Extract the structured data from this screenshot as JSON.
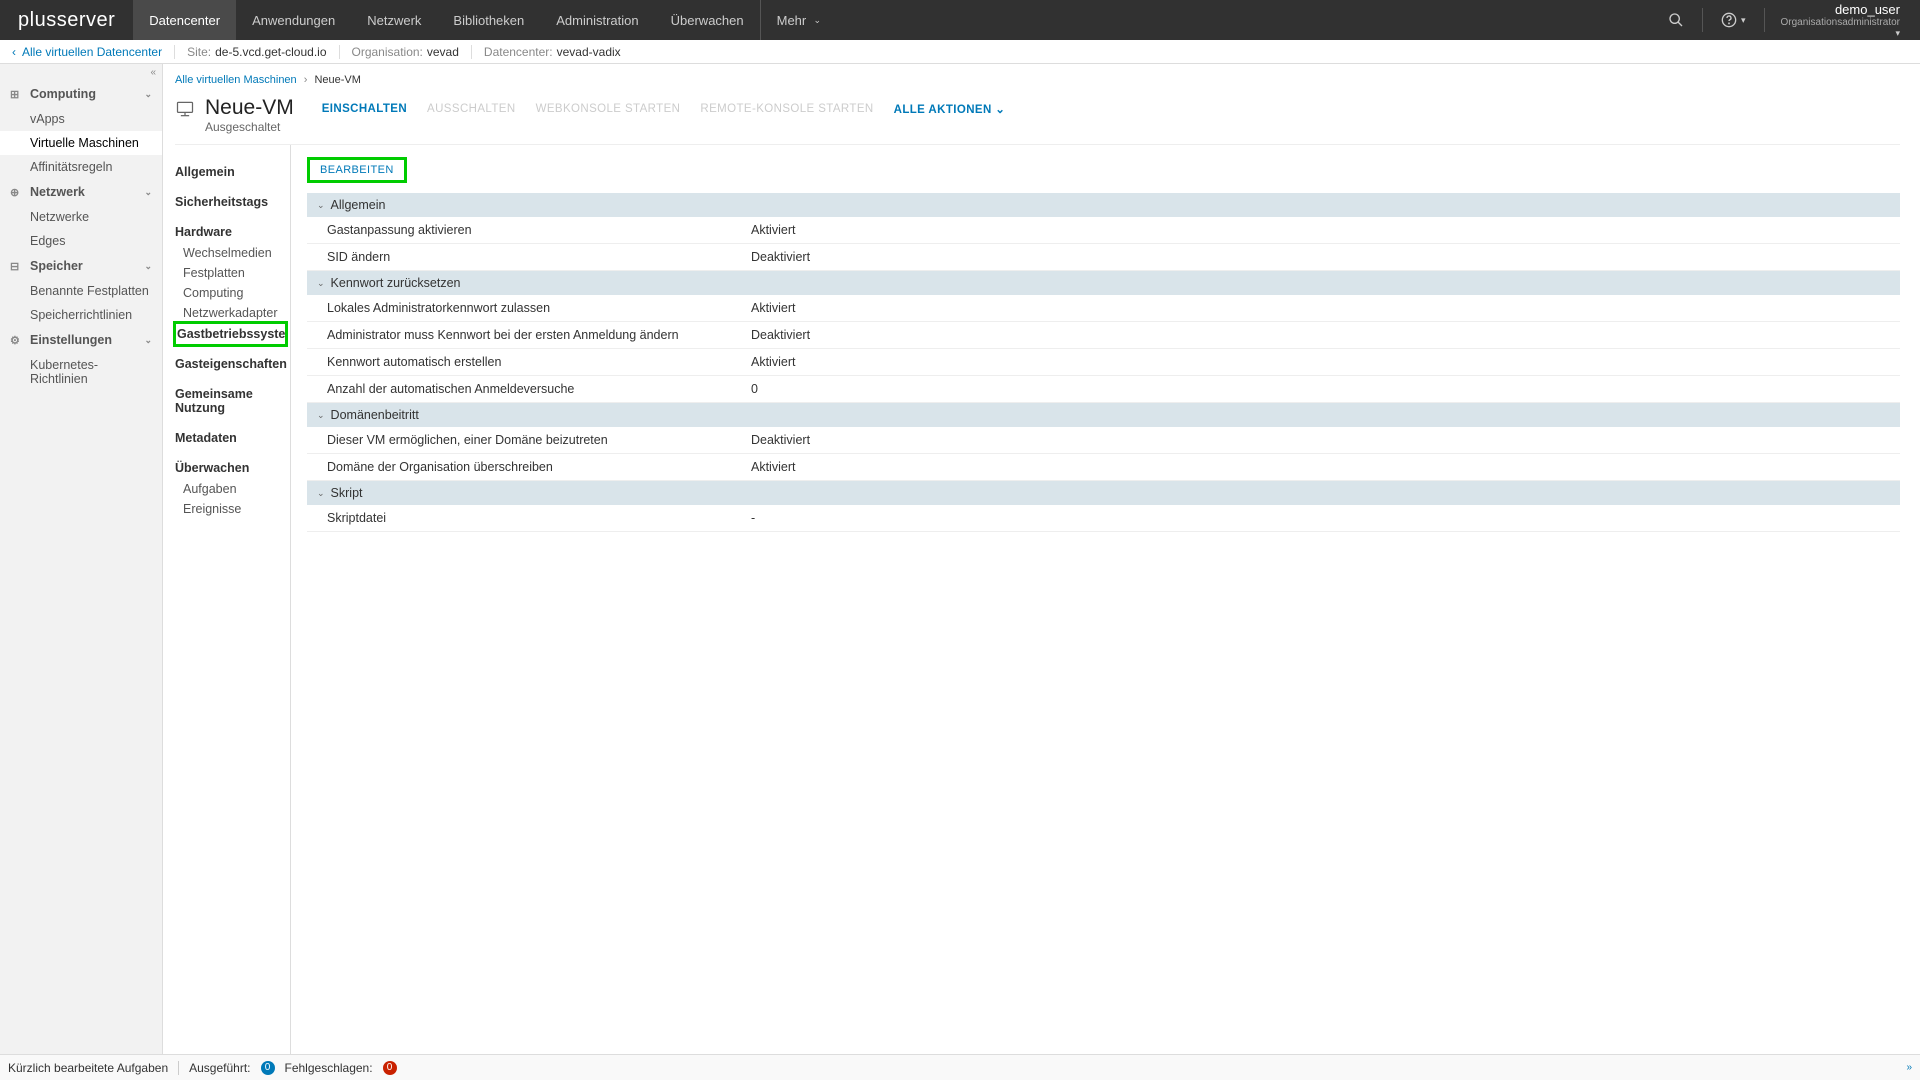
{
  "brand": "plusserver",
  "topnav": {
    "tabs": [
      "Datencenter",
      "Anwendungen",
      "Netzwerk",
      "Bibliotheken",
      "Administration",
      "Überwachen",
      "Mehr"
    ],
    "active": 0
  },
  "user": {
    "name": "demo_user",
    "role": "Organisationsadministrator"
  },
  "subheader": {
    "back": "Alle virtuellen Datencenter",
    "site_lab": "Site:",
    "site_val": "de-5.vcd.get-cloud.io",
    "org_lab": "Organisation:",
    "org_val": "vevad",
    "dc_lab": "Datencenter:",
    "dc_val": "vevad-vadix"
  },
  "sidebar": {
    "groups": [
      {
        "label": "Computing",
        "icon": "⊞",
        "items": [
          "vApps",
          "Virtuelle Maschinen",
          "Affinitätsregeln"
        ],
        "activeIndex": 1
      },
      {
        "label": "Netzwerk",
        "icon": "⊕",
        "items": [
          "Netzwerke",
          "Edges"
        ]
      },
      {
        "label": "Speicher",
        "icon": "⊟",
        "items": [
          "Benannte Festplatten",
          "Speicherrichtlinien"
        ]
      },
      {
        "label": "Einstellungen",
        "icon": "⚙",
        "items": [
          "Kubernetes-Richtlinien"
        ]
      }
    ]
  },
  "breadcrumb": {
    "root": "Alle virtuellen Maschinen",
    "current": "Neue-VM"
  },
  "vm": {
    "name": "Neue-VM",
    "status": "Ausgeschaltet"
  },
  "actions": {
    "einschalten": "EINSCHALTEN",
    "ausschalten": "AUSSCHALTEN",
    "web": "WEBKONSOLE STARTEN",
    "remote": "REMOTE-KONSOLE STARTEN",
    "all": "ALLE AKTIONEN ⌄"
  },
  "detailnav": {
    "items": [
      {
        "label": "Allgemein",
        "type": "main"
      },
      {
        "label": "Sicherheitstags",
        "type": "main"
      },
      {
        "label": "Hardware",
        "type": "main"
      },
      {
        "label": "Wechselmedien",
        "type": "sub"
      },
      {
        "label": "Festplatten",
        "type": "sub"
      },
      {
        "label": "Computing",
        "type": "sub"
      },
      {
        "label": "Netzwerkadapter",
        "type": "sub"
      },
      {
        "label": "Gastbetriebssystemanpassung",
        "type": "main",
        "selected": true
      },
      {
        "label": "Gasteigenschaften",
        "type": "main"
      },
      {
        "label": "Gemeinsame Nutzung",
        "type": "main"
      },
      {
        "label": "Metadaten",
        "type": "main"
      },
      {
        "label": "Überwachen",
        "type": "main"
      },
      {
        "label": "Aufgaben",
        "type": "sub"
      },
      {
        "label": "Ereignisse",
        "type": "sub"
      }
    ]
  },
  "bearbeiten": "BEARBEITEN",
  "panel": {
    "sections": [
      {
        "title": "Allgemein",
        "rows": [
          {
            "k": "Gastanpassung aktivieren",
            "v": "Aktiviert"
          },
          {
            "k": "SID ändern",
            "v": "Deaktiviert"
          }
        ]
      },
      {
        "title": "Kennwort zurücksetzen",
        "rows": [
          {
            "k": "Lokales Administratorkennwort zulassen",
            "v": "Aktiviert"
          },
          {
            "k": "Administrator muss Kennwort bei der ersten Anmeldung ändern",
            "v": "Deaktiviert"
          },
          {
            "k": "Kennwort automatisch erstellen",
            "v": "Aktiviert"
          },
          {
            "k": "Anzahl der automatischen Anmeldeversuche",
            "v": "0"
          }
        ]
      },
      {
        "title": "Domänenbeitritt",
        "rows": [
          {
            "k": "Dieser VM ermöglichen, einer Domäne beizutreten",
            "v": "Deaktiviert"
          },
          {
            "k": "Domäne der Organisation überschreiben",
            "v": "Aktiviert"
          }
        ]
      },
      {
        "title": "Skript",
        "rows": [
          {
            "k": "Skriptdatei",
            "v": "-"
          }
        ]
      }
    ]
  },
  "footer": {
    "recent": "Kürzlich bearbeitete Aufgaben",
    "running": "Ausgeführt:",
    "running_n": "0",
    "failed": "Fehlgeschlagen:",
    "failed_n": "0"
  }
}
